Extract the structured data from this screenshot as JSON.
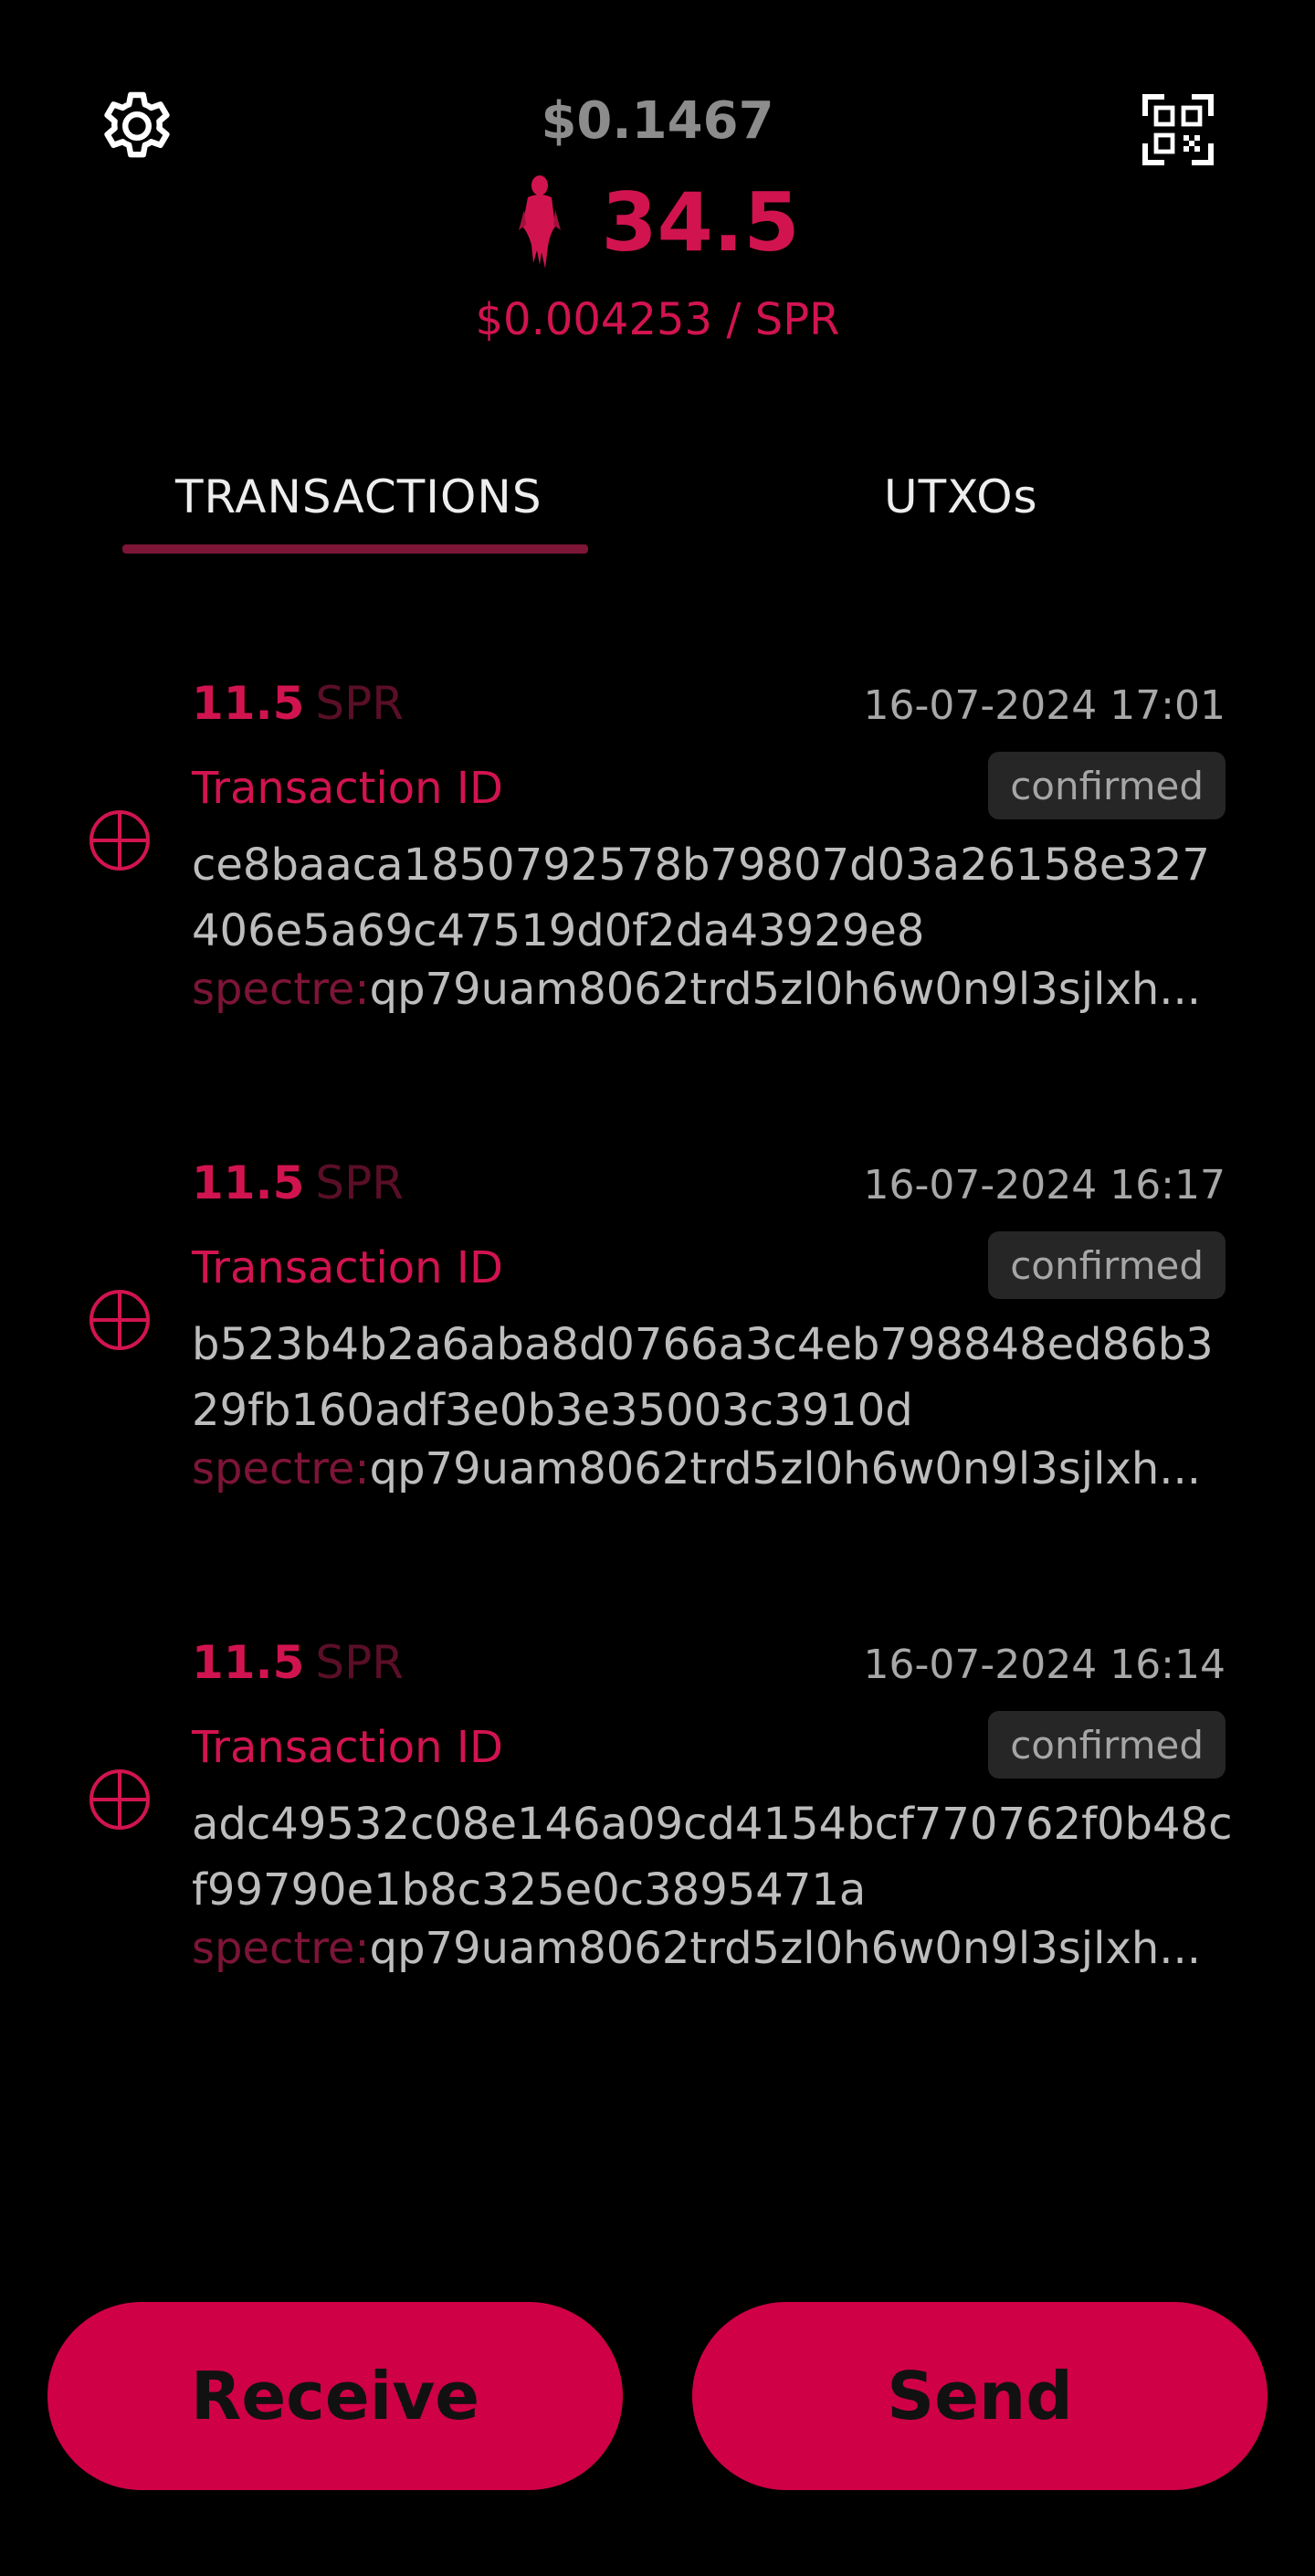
{
  "header": {
    "balance_usd": "$0.1467",
    "balance_amount": "34.5",
    "price_per_unit": "$0.004253 / SPR",
    "settings_icon": "gear-icon",
    "qr_icon": "qr-code-icon",
    "logo_icon": "spectre-ghost-logo"
  },
  "tabs": [
    {
      "label": "TRANSACTIONS",
      "active": true
    },
    {
      "label": "UTXOs",
      "active": false
    }
  ],
  "transactions": [
    {
      "amount": "11.5",
      "unit": "SPR",
      "timestamp": "16-07-2024 17:01",
      "id_label": "Transaction ID",
      "status": "confirmed",
      "tx_id": "ce8baaca1850792578b79807d03a26158e327406e5a69c47519d0f2da43929e8",
      "address_prefix": "spectre:",
      "address": "qp79uam8062trd5zl0h6w0n9l3sjlxh..."
    },
    {
      "amount": "11.5",
      "unit": "SPR",
      "timestamp": "16-07-2024 16:17",
      "id_label": "Transaction ID",
      "status": "confirmed",
      "tx_id": "b523b4b2a6aba8d0766a3c4eb798848ed86b329fb160adf3e0b3e35003c3910d",
      "address_prefix": "spectre:",
      "address": "qp79uam8062trd5zl0h6w0n9l3sjlxh..."
    },
    {
      "amount": "11.5",
      "unit": "SPR",
      "timestamp": "16-07-2024 16:14",
      "id_label": "Transaction ID",
      "status": "confirmed",
      "tx_id": "adc49532c08e146a09cd4154bcf770762f0b48cf99790e1b8c325e0c3895471a",
      "address_prefix": "spectre:",
      "address": "qp79uam8062trd5zl0h6w0n9l3sjlxh..."
    }
  ],
  "actions": {
    "receive_label": "Receive",
    "send_label": "Send"
  },
  "colors": {
    "accent": "#d1144f",
    "button": "#cf0046",
    "background": "#000000"
  }
}
